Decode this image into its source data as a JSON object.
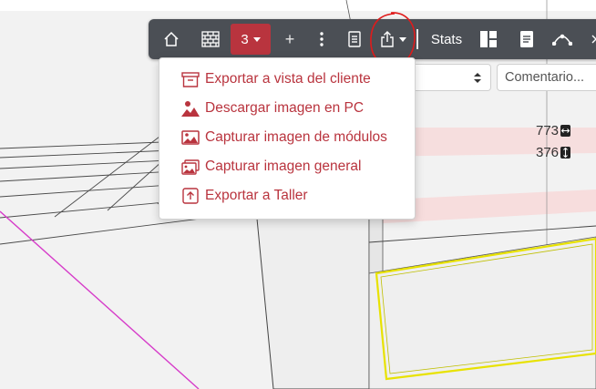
{
  "toolbar": {
    "module_count": "3",
    "plus": "+",
    "stats_label": "Stats"
  },
  "export_menu": {
    "items": [
      {
        "label": "Exportar a vista del cliente",
        "icon": "archive-box-icon"
      },
      {
        "label": "Descargar imagen en PC",
        "icon": "user-image-icon"
      },
      {
        "label": "Capturar imagen de módulos",
        "icon": "image-icon"
      },
      {
        "label": "Capturar imagen general",
        "icon": "images-icon"
      },
      {
        "label": "Exportar a Taller",
        "icon": "upload-arrow-icon"
      }
    ]
  },
  "form": {
    "comment_placeholder": "Comentario..."
  },
  "dimensions": {
    "width": "773",
    "height": "376"
  },
  "colors": {
    "accent": "#b9343e",
    "toolbar_bg": "#4b4f55",
    "annotation_circle": "#e01b1b",
    "selection_outline": "#e8e200"
  }
}
